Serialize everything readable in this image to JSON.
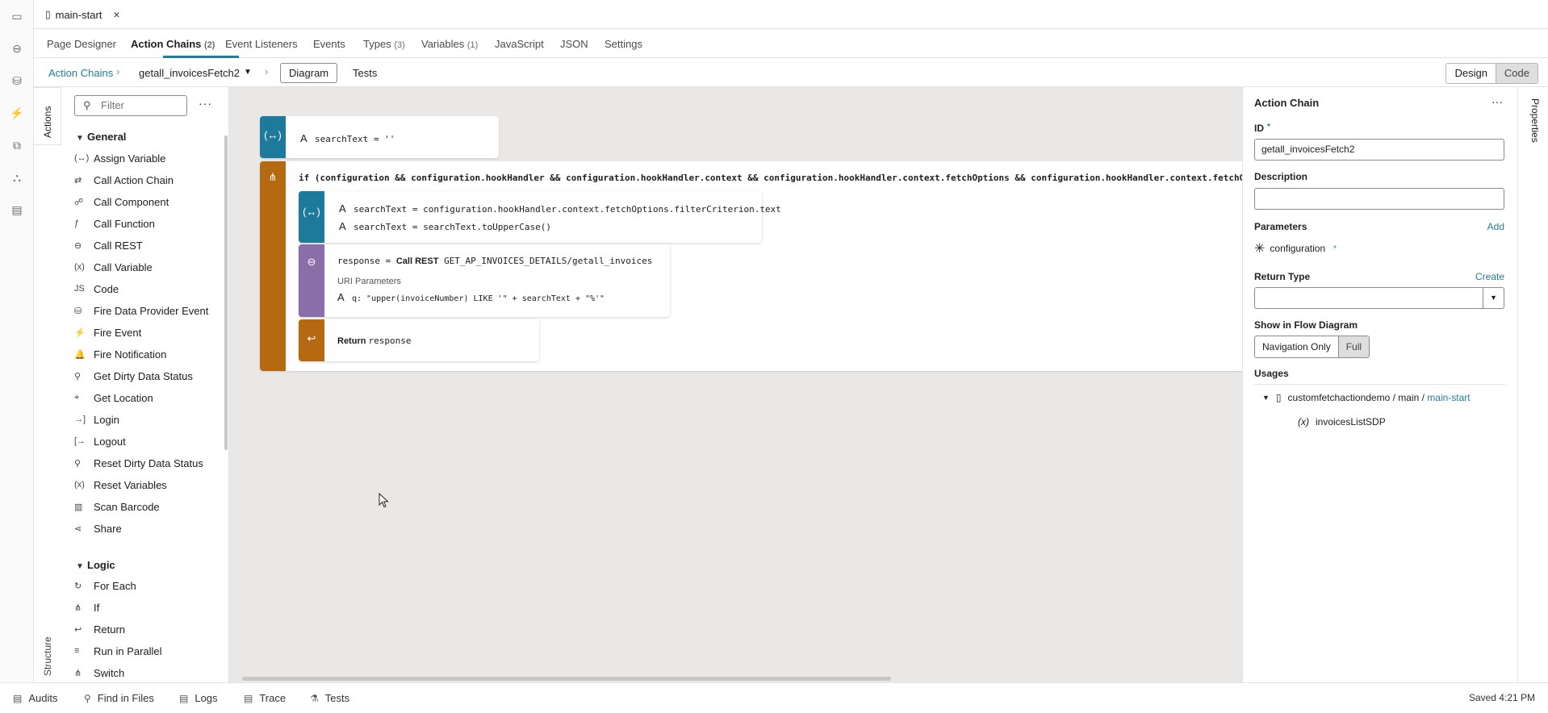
{
  "file_tab": {
    "name": "main-start",
    "close": "×"
  },
  "editor_tabs": [
    {
      "label": "Page Designer",
      "count": ""
    },
    {
      "label": "Action Chains",
      "count": "(2)"
    },
    {
      "label": "Event Listeners",
      "count": ""
    },
    {
      "label": "Events",
      "count": ""
    },
    {
      "label": "Types",
      "count": "(3)"
    },
    {
      "label": "Variables",
      "count": "(1)"
    },
    {
      "label": "JavaScript",
      "count": ""
    },
    {
      "label": "JSON",
      "count": ""
    },
    {
      "label": "Settings",
      "count": ""
    }
  ],
  "breadcrumb": {
    "root": "Action Chains",
    "current": "getall_invoicesFetch2"
  },
  "view_tabs": {
    "diagram": "Diagram",
    "tests": "Tests"
  },
  "mode_toggle": {
    "design": "Design",
    "code": "Code"
  },
  "side_tabs": {
    "actions": "Actions",
    "structure": "Structure",
    "properties": "Properties"
  },
  "palette": {
    "filter_placeholder": "Filter",
    "more": "···",
    "groups": [
      {
        "title": "General",
        "items": [
          {
            "label": "Assign Variable",
            "icon": "(↔)"
          },
          {
            "label": "Call Action Chain",
            "icon": "⇄"
          },
          {
            "label": "Call Component",
            "icon": "☍"
          },
          {
            "label": "Call Function",
            "icon": "ƒ"
          },
          {
            "label": "Call REST",
            "icon": "⊖"
          },
          {
            "label": "Call Variable",
            "icon": "(x)"
          },
          {
            "label": "Code",
            "icon": "JS"
          },
          {
            "label": "Fire Data Provider Event",
            "icon": "⛁"
          },
          {
            "label": "Fire Event",
            "icon": "⚡"
          },
          {
            "label": "Fire Notification",
            "icon": "🔔"
          },
          {
            "label": "Get Dirty Data Status",
            "icon": "⚲"
          },
          {
            "label": "Get Location",
            "icon": "⌖"
          },
          {
            "label": "Login",
            "icon": "→]"
          },
          {
            "label": "Logout",
            "icon": "[→"
          },
          {
            "label": "Reset Dirty Data Status",
            "icon": "⚲"
          },
          {
            "label": "Reset Variables",
            "icon": "(x)"
          },
          {
            "label": "Scan Barcode",
            "icon": "▥"
          },
          {
            "label": "Share",
            "icon": "⋖"
          }
        ]
      },
      {
        "title": "Logic",
        "items": [
          {
            "label": "For Each",
            "icon": "↻"
          },
          {
            "label": "If",
            "icon": "⋔"
          },
          {
            "label": "Return",
            "icon": "↩"
          },
          {
            "label": "Run in Parallel",
            "icon": "≡"
          },
          {
            "label": "Switch",
            "icon": "⋔"
          }
        ]
      }
    ]
  },
  "diagram": {
    "assign1": {
      "line": "searchText = ''"
    },
    "if_node": {
      "condition": "if (configuration && configuration.hookHandler && configuration.hookHandler.context && configuration.hookHandler.context.fetchOptions && configuration.hookHandler.context.fetchOp"
    },
    "assign2": {
      "line1": "searchText = configuration.hookHandler.context.fetchOptions.filterCriterion.text",
      "line2": "searchText = searchText.toUpperCase()"
    },
    "rest": {
      "prefix": "response = ",
      "call": "Call REST",
      "endpoint": "GET_AP_INVOICES_DETAILS/getall_invoices",
      "uri_label": "URI Parameters",
      "param": "q: \"upper(invoiceNumber) LIKE '\" + searchText + \"%'\""
    },
    "return_node": {
      "keyword": "Return",
      "value": "response"
    }
  },
  "properties": {
    "title": "Action Chain",
    "more": "···",
    "id_label": "ID",
    "id_value": "getall_invoicesFetch2",
    "description_label": "Description",
    "description_value": "",
    "parameters_label": "Parameters",
    "add_label": "Add",
    "parameter": "configuration",
    "return_type_label": "Return Type",
    "create_label": "Create",
    "return_type_value": "",
    "flow_label": "Show in Flow Diagram",
    "flow_nav": "Navigation Only",
    "flow_full": "Full",
    "usages_label": "Usages",
    "usage_path_prefix": "customfetchactiondemo / main / ",
    "usage_path_link": "main-start",
    "usage_child": "invoicesListSDP"
  },
  "status_bar": {
    "items": [
      "Audits",
      "Find in Files",
      "Logs",
      "Trace",
      "Tests"
    ],
    "saved": "Saved 4:21 PM"
  },
  "colors": {
    "accent": "#227e9e",
    "teal_node": "#1d7a9a",
    "orange_node": "#b56a12",
    "purple_node": "#8a6ea8",
    "canvas": "#e9e8e6"
  }
}
